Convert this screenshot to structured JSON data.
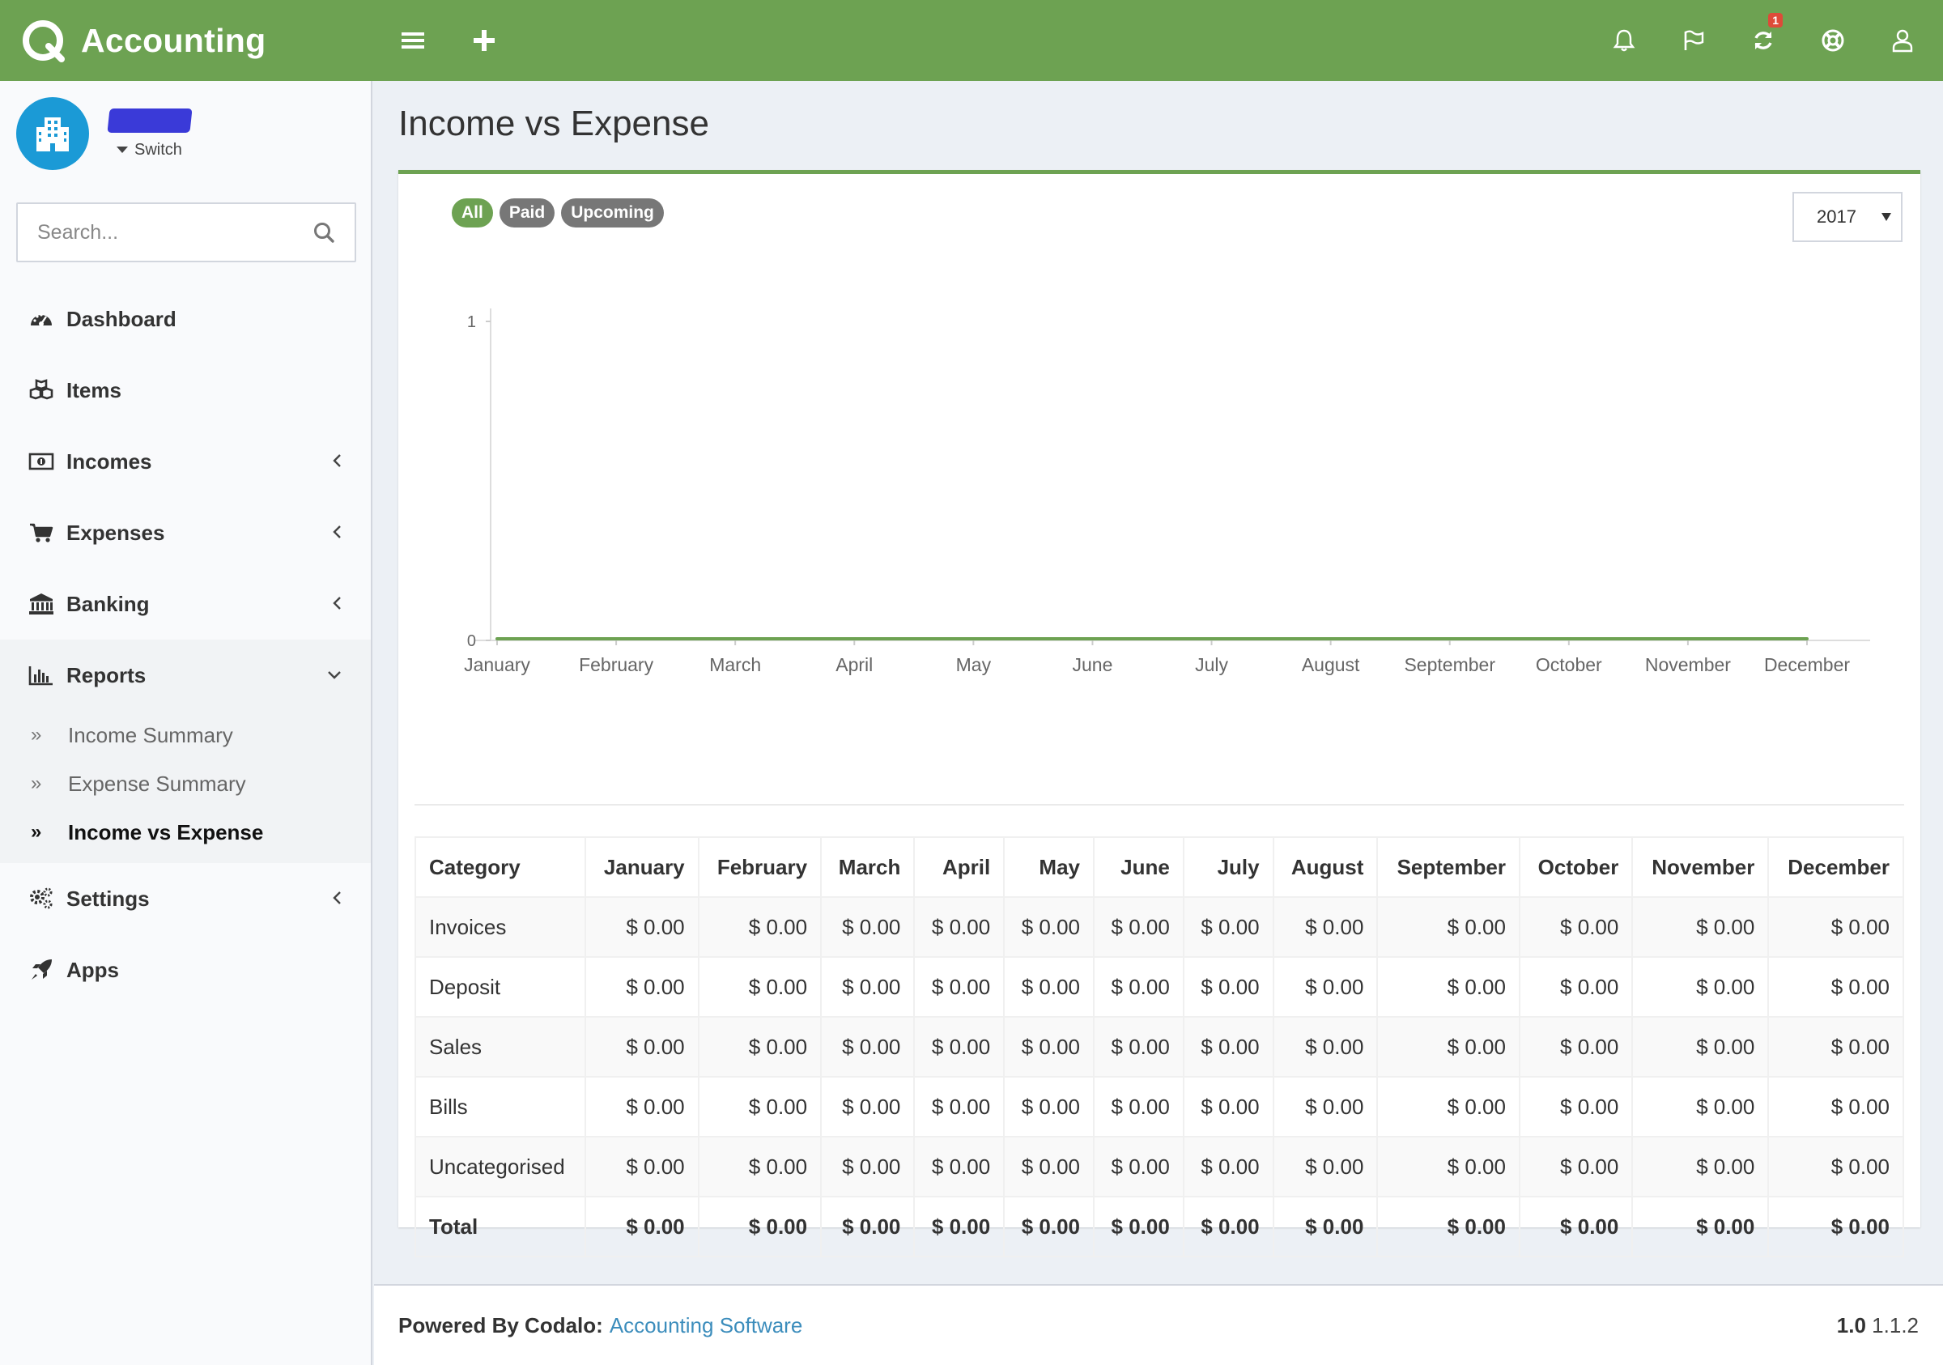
{
  "app": {
    "name": "Accounting"
  },
  "header": {
    "notifications_badge": "1"
  },
  "user": {
    "switch_label": "Switch"
  },
  "search": {
    "placeholder": "Search..."
  },
  "sidebar": {
    "items": [
      {
        "label": "Dashboard",
        "icon": "dashboard-icon"
      },
      {
        "label": "Items",
        "icon": "cubes-icon"
      },
      {
        "label": "Incomes",
        "icon": "money-icon"
      },
      {
        "label": "Expenses",
        "icon": "cart-icon"
      },
      {
        "label": "Banking",
        "icon": "bank-icon"
      },
      {
        "label": "Reports",
        "icon": "bar-chart-icon"
      },
      {
        "label": "Settings",
        "icon": "gears-icon"
      },
      {
        "label": "Apps",
        "icon": "rocket-icon"
      }
    ],
    "reports_sub": [
      {
        "label": "Income Summary"
      },
      {
        "label": "Expense Summary"
      },
      {
        "label": "Income vs Expense"
      }
    ]
  },
  "page": {
    "title": "Income vs Expense"
  },
  "filters": {
    "all": "All",
    "paid": "Paid",
    "upcoming": "Upcoming",
    "year": "2017"
  },
  "chart_data": {
    "type": "line",
    "categories": [
      "January",
      "February",
      "March",
      "April",
      "May",
      "June",
      "July",
      "August",
      "September",
      "October",
      "November",
      "December"
    ],
    "series": [
      {
        "values": [
          0,
          0,
          0,
          0,
          0,
          0,
          0,
          0,
          0,
          0,
          0,
          0
        ],
        "color": "#6da252"
      }
    ],
    "ylim": [
      0,
      1
    ],
    "yticks": [
      "0",
      "1"
    ],
    "grid": false
  },
  "table": {
    "headers": [
      "Category",
      "January",
      "February",
      "March",
      "April",
      "May",
      "June",
      "July",
      "August",
      "September",
      "October",
      "November",
      "December"
    ],
    "rows": [
      [
        "Invoices",
        "$ 0.00",
        "$ 0.00",
        "$ 0.00",
        "$ 0.00",
        "$ 0.00",
        "$ 0.00",
        "$ 0.00",
        "$ 0.00",
        "$ 0.00",
        "$ 0.00",
        "$ 0.00",
        "$ 0.00"
      ],
      [
        "Deposit",
        "$ 0.00",
        "$ 0.00",
        "$ 0.00",
        "$ 0.00",
        "$ 0.00",
        "$ 0.00",
        "$ 0.00",
        "$ 0.00",
        "$ 0.00",
        "$ 0.00",
        "$ 0.00",
        "$ 0.00"
      ],
      [
        "Sales",
        "$ 0.00",
        "$ 0.00",
        "$ 0.00",
        "$ 0.00",
        "$ 0.00",
        "$ 0.00",
        "$ 0.00",
        "$ 0.00",
        "$ 0.00",
        "$ 0.00",
        "$ 0.00",
        "$ 0.00"
      ],
      [
        "Bills",
        "$ 0.00",
        "$ 0.00",
        "$ 0.00",
        "$ 0.00",
        "$ 0.00",
        "$ 0.00",
        "$ 0.00",
        "$ 0.00",
        "$ 0.00",
        "$ 0.00",
        "$ 0.00",
        "$ 0.00"
      ],
      [
        "Uncategorised",
        "$ 0.00",
        "$ 0.00",
        "$ 0.00",
        "$ 0.00",
        "$ 0.00",
        "$ 0.00",
        "$ 0.00",
        "$ 0.00",
        "$ 0.00",
        "$ 0.00",
        "$ 0.00",
        "$ 0.00"
      ]
    ],
    "total": [
      "Total",
      "$ 0.00",
      "$ 0.00",
      "$ 0.00",
      "$ 0.00",
      "$ 0.00",
      "$ 0.00",
      "$ 0.00",
      "$ 0.00",
      "$ 0.00",
      "$ 0.00",
      "$ 0.00",
      "$ 0.00"
    ]
  },
  "footer": {
    "powered_by": "Powered By Codalo:",
    "link_text": "Accounting Software",
    "version": "1.0",
    "build": "1.1.2"
  },
  "colors": {
    "brand": "#6da252",
    "link": "#3c8dbc",
    "avatar": "#1b9ad6"
  }
}
